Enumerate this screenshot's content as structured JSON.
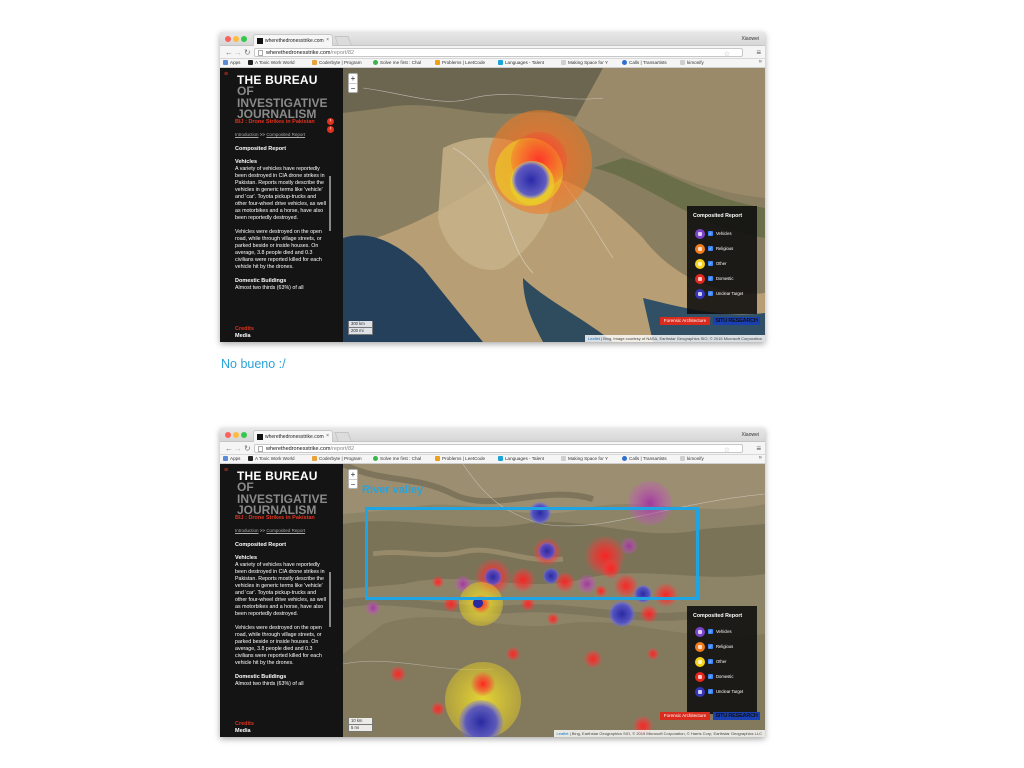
{
  "caption": "No bueno :/",
  "browser": {
    "tab_title": "wherethedronesstrike.com",
    "user": "Xiaowei",
    "url_host": "wherethedronesstrike.com",
    "url_path": "/report/82",
    "bookmarks": [
      {
        "label": "Apps",
        "color": "#5b8bd6"
      },
      {
        "label": "A Toxic Work World",
        "color": "#222222"
      },
      {
        "label": "Coderbyte | Program",
        "color": "#e8a33a"
      },
      {
        "label": "Solve me first : Chal",
        "color": "#39b54a"
      },
      {
        "label": "Problems | LeetCode",
        "color": "#f0a018"
      },
      {
        "label": "Languages - Talent",
        "color": "#1aa5d6"
      },
      {
        "label": "Making Space for Y",
        "color": "#cfcfcf"
      },
      {
        "label": "Calls | Transartists",
        "color": "#2e6fd1"
      },
      {
        "label": "kimonify",
        "color": "#cfcfcf"
      }
    ]
  },
  "sidebar": {
    "logo_line1": "THE BUREAU",
    "logo_line2": "OF INVESTIGATIVE JOURNALISM",
    "title": "BIJ : Drone Strikes in Pakistan",
    "crumb_intro": "Introduction",
    "crumb_sep": ">>",
    "crumb_report": "Composited Report",
    "heading": "Composited Report",
    "section1_title": "Vehicles",
    "para1": "A variety of vehicles have reportedly been destroyed in CIA drone strikes in Pakistan. Reports mostly describe the vehicles in generic terms like 'vehicle' and 'car'. Toyota pickup-trucks and other four-wheel drive vehicles, as well as motorbikes and a horse, have also been reportedly destroyed.",
    "para2": "Vehicles were destroyed on the open road, while through village streets, or parked beside or inside houses. On average, 3.8 people died and 0.3 civilians were reported killed for each vehicle hit by the drones.",
    "section2_title": "Domestic Buildings",
    "section2_cut": "Almost two thirds (63%) of all",
    "credits": "Credits",
    "media": "Media"
  },
  "legend": {
    "title": "Composited Report",
    "items": [
      {
        "label": "Vehicles",
        "color": "#7a43c8"
      },
      {
        "label": "Religious",
        "color": "#ef7d1f"
      },
      {
        "label": "Other",
        "color": "#f5d21b"
      },
      {
        "label": "Domestic",
        "color": "#e3271d"
      },
      {
        "label": "Unclear Target",
        "color": "#3535b8"
      }
    ]
  },
  "map": {
    "zoom_in": "+",
    "zoom_out": "−",
    "scale_km": "300 km",
    "scale_mi": "200 mi",
    "scale_km2": "10 km",
    "scale_mi2": "5 mi",
    "badge_fa": "Forensic Architecture",
    "badge_situ": "SITU RESEARCH",
    "attr1_link": "Leaflet",
    "attr1_text": " | Bing, Image courtesy of NASA, Earthstar Geographics SIO, © 2015 Microsoft Corporation",
    "attr2_link": "Leaflet",
    "attr2_text": " | Bing, Earthstar Geographics SIO, © 2015 Microsoft Corporation, © Harris Corp, Earthstar Geographics LLC",
    "river_label": "River valley"
  }
}
